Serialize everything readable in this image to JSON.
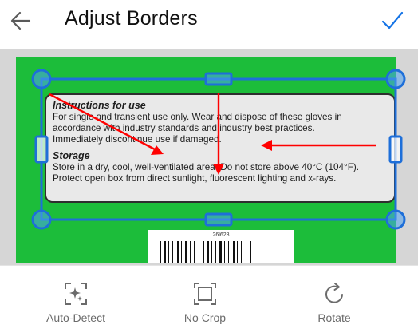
{
  "header": {
    "title": "Adjust Borders",
    "back_icon": "arrow-left-icon",
    "confirm_icon": "checkmark-icon",
    "accent": "#1473e6"
  },
  "document": {
    "section1_heading": "Instructions for use",
    "section1_lines": [
      "For single and transient use only. Wear and dispose of these gloves in",
      "accordance with industry standards and industry best practices.",
      "Immediately discontinue use if damaged."
    ],
    "section2_heading": "Storage",
    "section2_lines": [
      "Store in a dry, cool, well-ventilated area. Do not store above 40°C (104°F).",
      "Protect open box from direct sunlight, fluorescent lighting and x-rays."
    ],
    "barcode_number": "26l628"
  },
  "overlay": {
    "border_color": "#1e6fd9",
    "handle_fill": "#4fa3f0",
    "arrow_color": "#ff0000"
  },
  "toolbar": {
    "items": [
      {
        "label": "Auto-Detect",
        "icon": "sparkle-crop-icon"
      },
      {
        "label": "No Crop",
        "icon": "full-frame-icon"
      },
      {
        "label": "Rotate",
        "icon": "rotate-icon"
      }
    ]
  }
}
